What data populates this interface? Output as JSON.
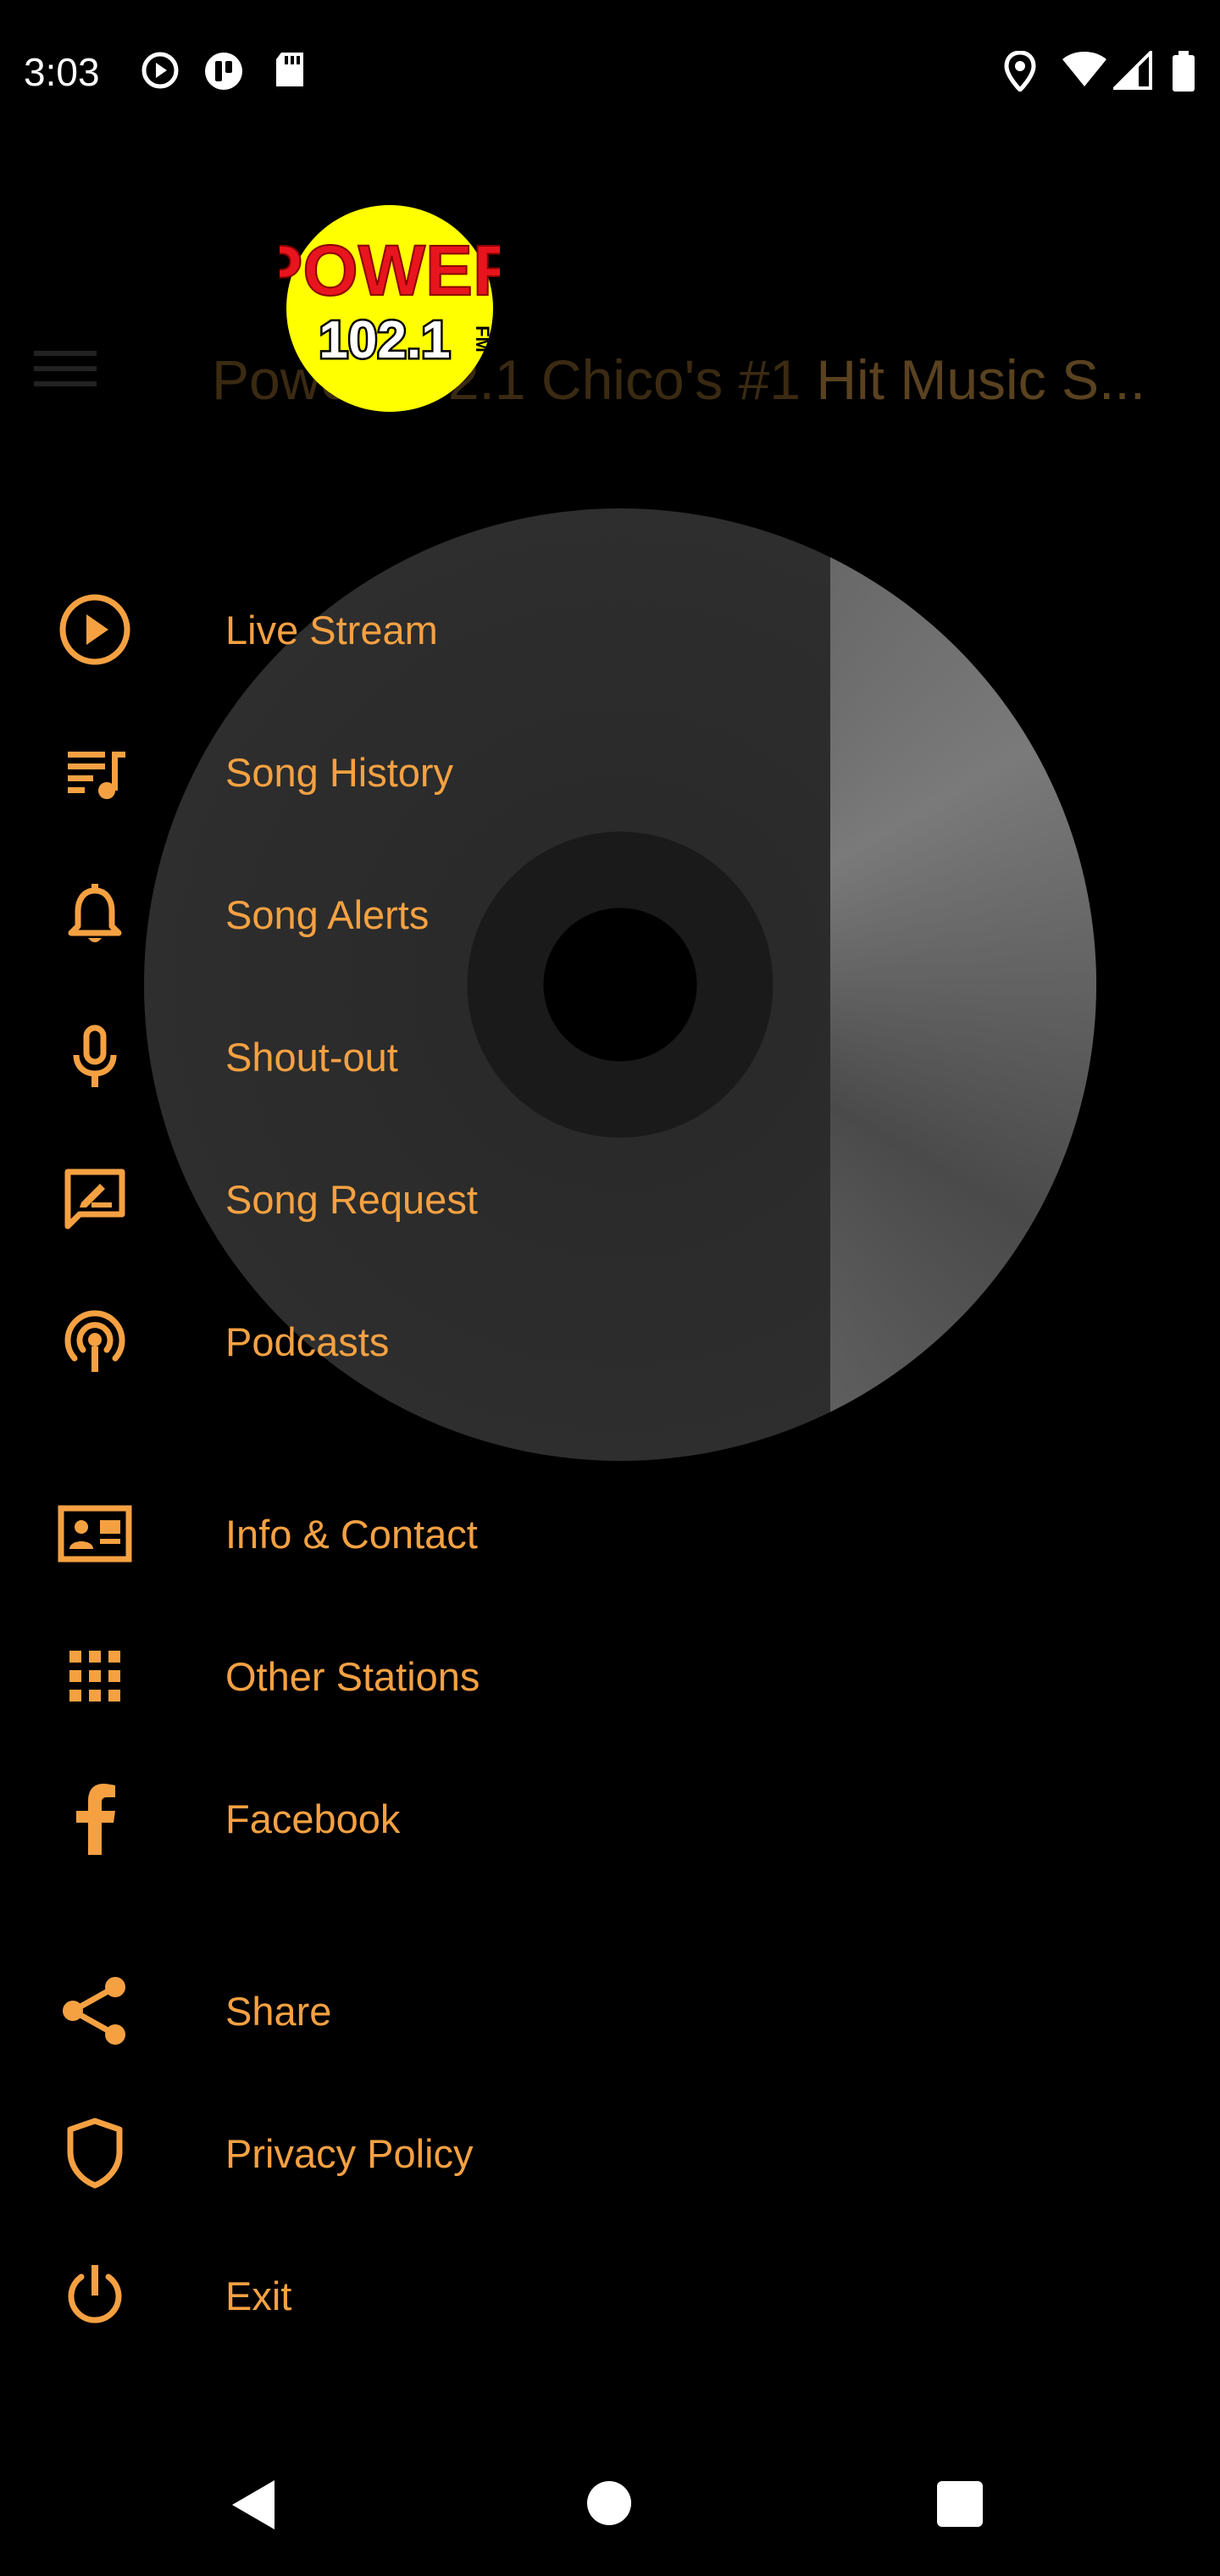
{
  "status_bar": {
    "time": "3:03",
    "icons": [
      "play-circle-icon",
      "accessibility-icon",
      "sd-card-icon",
      "location-icon",
      "wifi-icon",
      "signal-icon",
      "battery-icon"
    ]
  },
  "app_bar": {
    "title_dim": "Power 102.1 Chico's #1 ",
    "title_bright": "Hit Music S..."
  },
  "logo": {
    "brand": "POWER",
    "frequency": "102.1",
    "band": "FM"
  },
  "menu": {
    "items": [
      {
        "label": "Live Stream",
        "icon": "play-circle-icon"
      },
      {
        "label": "Song History",
        "icon": "playlist-icon"
      },
      {
        "label": "Song Alerts",
        "icon": "bell-icon"
      },
      {
        "label": "Shout-out",
        "icon": "microphone-icon"
      },
      {
        "label": "Song Request",
        "icon": "request-message-icon"
      },
      {
        "label": "Podcasts",
        "icon": "podcast-icon"
      },
      {
        "label": "Info & Contact",
        "icon": "contact-card-icon"
      },
      {
        "label": "Other Stations",
        "icon": "grid-icon"
      },
      {
        "label": "Facebook",
        "icon": "facebook-icon"
      },
      {
        "label": "Share",
        "icon": "share-icon"
      },
      {
        "label": "Privacy Policy",
        "icon": "shield-icon"
      },
      {
        "label": "Exit",
        "icon": "power-icon"
      }
    ]
  },
  "colors": {
    "accent": "#f5a142",
    "background": "#000000",
    "logo_yellow": "#ffff00",
    "logo_red": "#e8141e"
  },
  "navigation_bar": {
    "icons": [
      "back-icon",
      "home-icon",
      "recents-icon"
    ]
  }
}
